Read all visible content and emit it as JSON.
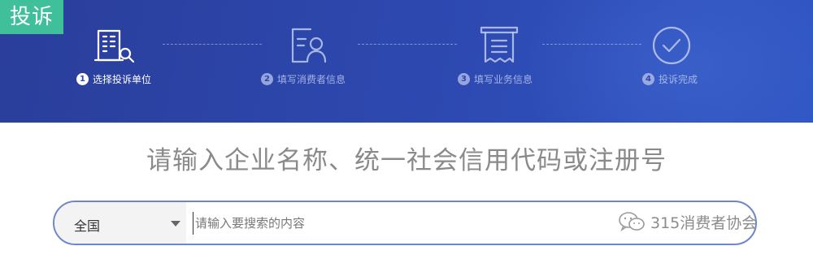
{
  "banner": {
    "tag": "投诉",
    "steps": [
      {
        "num": "1",
        "label": "选择投诉单位",
        "icon": "building-search-icon",
        "state": "active"
      },
      {
        "num": "2",
        "label": "填写消费者信息",
        "icon": "user-card-icon",
        "state": "inactive"
      },
      {
        "num": "3",
        "label": "填写业务信息",
        "icon": "document-icon",
        "state": "inactive"
      },
      {
        "num": "4",
        "label": "投诉完成",
        "icon": "check-circle-icon",
        "state": "inactive"
      }
    ]
  },
  "main": {
    "heading": "请输入企业名称、统一社会信用代码或注册号"
  },
  "search": {
    "region": "全国",
    "placeholder": "请输入要搜索的内容"
  },
  "watermark": {
    "text": "315消费者协会",
    "icon": "wechat-icon"
  },
  "colors": {
    "banner": "#2d47ad",
    "tag": "#3fbf9a",
    "search_border": "#6d86cc"
  }
}
